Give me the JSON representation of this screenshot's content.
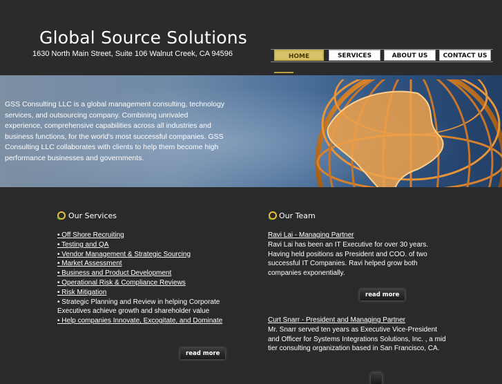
{
  "site": {
    "title": "Global Source Solutions",
    "address": "1630 North Main Street,  Suite 106   Walnut Creek, CA  94596"
  },
  "nav": {
    "items": [
      {
        "label": "HOME",
        "active": true
      },
      {
        "label": "SERVICES",
        "active": false
      },
      {
        "label": "ABOUT US",
        "active": false
      },
      {
        "label": "CONTACT US",
        "active": false
      }
    ]
  },
  "hero": {
    "text": "GSS Consulting LLC is a global management consulting, technology services, and outsourcing company.  Combining unrivaled experience, comprehensive capabilities across all industries and business functions, for the world's most successful companies.  GSS Consulting LLC collaborates with clients to help them become high performance businesses and governments."
  },
  "services": {
    "title": "Our Services",
    "items": [
      "• Off Shore Recruiting",
      "• Testing and QA",
      "• Vendor Management & Strategic Sourcing",
      "• Market Assessment",
      "• Business and Product Development",
      "• Operational Risk & Compliance Reviews",
      "• Risk Mitigation",
      "• Strategic Planning and Review in helping Corporate Executives achieve growth and shareholder value",
      "• Help companies Innovate, Excogitate, and Dominate"
    ],
    "read_more": "read more"
  },
  "team": {
    "title": "Our Team",
    "members": [
      {
        "name": "Ravi Lai - Managing Partner",
        "bio": "Ravi Lai has been an IT Executive for over 30 years.  Having held positions as President and COO. of two successful IT Companies. Ravi helped grow both companies exponentially."
      },
      {
        "name": "Curt Snarr - President and Managing Partner",
        "bio": "Mr. Snarr served ten years as Executive Vice-President and Officer for Systems Integrations Solutions, Inc. , a mid tier consulting organization based in San Francisco, CA."
      }
    ],
    "read_more": "read more"
  },
  "colors": {
    "background": "#2a2a2a",
    "nav_active": "#d9c36a",
    "hero_left": "#7c8fa3",
    "hero_right": "#223f66",
    "globe": "#e08a2c"
  }
}
